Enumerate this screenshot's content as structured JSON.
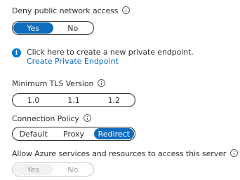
{
  "deny_public": {
    "label": "Deny public network access",
    "options": [
      "Yes",
      "No"
    ],
    "selected": "Yes"
  },
  "private_endpoint": {
    "info_icon_glyph": "i",
    "text": "Click here to create a new private endpoint.",
    "link": "Create Private Endpoint"
  },
  "tls": {
    "label": "Minimum TLS Version",
    "options": [
      "1.0",
      "1.1",
      "1.2"
    ],
    "selected": null
  },
  "connection_policy": {
    "label": "Connection Policy",
    "options": [
      "Default",
      "Proxy",
      "Redirect"
    ],
    "selected": "Redirect"
  },
  "allow_azure": {
    "label": "Allow Azure services and resources to access this server",
    "options": [
      "Yes",
      "No"
    ],
    "selected": "Yes",
    "disabled": true
  },
  "colors": {
    "accent": "#0f6cbd",
    "info_blue": "#0078d4",
    "text": "#323130",
    "disabled_text": "#a19f9d"
  }
}
